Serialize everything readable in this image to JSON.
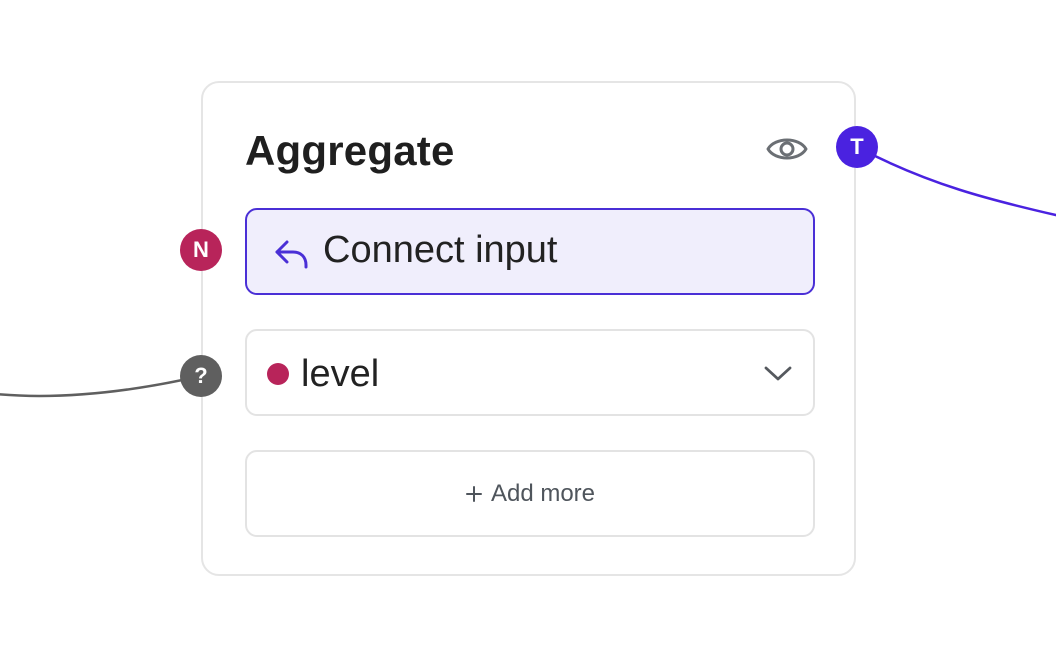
{
  "node": {
    "title": "Aggregate",
    "connect_input_label": "Connect input",
    "field": {
      "name": "level",
      "dot_color": "#b8245a"
    },
    "add_more_label": "Add more"
  },
  "handles": {
    "output_type": {
      "letter": "T",
      "color": "#4a22e0"
    },
    "input_type": {
      "letter": "N",
      "color": "#b8245a"
    },
    "field_port": {
      "letter": "?",
      "color": "#5f5f5f"
    }
  },
  "colors": {
    "accent": "#4a2fd6",
    "accent_bg": "#f0eefc",
    "edge_output": "#4a22e0",
    "edge_input": "#5f5f5f",
    "border": "#e5e5e5"
  },
  "icons": {
    "visibility": "eye-icon",
    "connect": "reply-arrow-icon",
    "dropdown": "chevron-down-icon",
    "add": "plus-icon"
  }
}
